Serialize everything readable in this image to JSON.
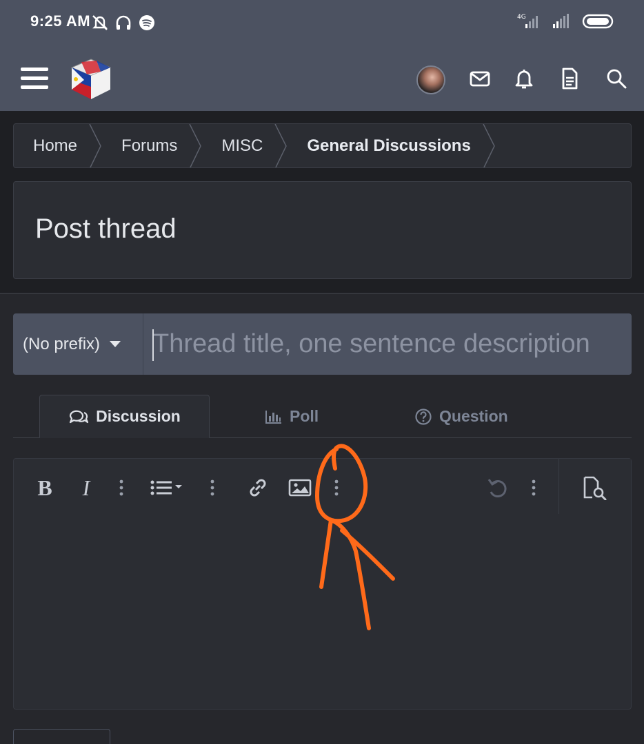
{
  "status_bar": {
    "time": "9:25 AM",
    "left_icons": [
      "mute-notifications-icon",
      "headphones-icon",
      "spotify-icon"
    ],
    "right_icons": [
      "4g-signal-icon",
      "signal-icon",
      "battery-icon"
    ],
    "network": "4G"
  },
  "header": {
    "menu_icon": "hamburger-icon",
    "logo": "site-logo",
    "icons": [
      "avatar",
      "mail-icon",
      "bell-icon",
      "document-icon",
      "search-icon"
    ]
  },
  "breadcrumb": {
    "items": [
      "Home",
      "Forums",
      "MISC",
      "General Discussions"
    ]
  },
  "page": {
    "title": "Post thread"
  },
  "thread_form": {
    "prefix_value": "(No prefix)",
    "title_placeholder": "Thread title, one sentence description"
  },
  "tabs": [
    {
      "label": "Discussion",
      "icon": "chat-bubbles-icon",
      "active": true
    },
    {
      "label": "Poll",
      "icon": "bar-chart-icon",
      "active": false
    },
    {
      "label": "Question",
      "icon": "question-circle-icon",
      "active": false
    }
  ],
  "toolbar": {
    "bold": "B",
    "italic": "I",
    "buttons": [
      "bold-button",
      "italic-button",
      "more-text-options",
      "list-button",
      "more-paragraph-options",
      "link-button",
      "image-button",
      "more-insert-options",
      "undo-button",
      "more-misc-options",
      "preview-button"
    ]
  },
  "colors": {
    "header_bg": "#4c5261",
    "page_bg": "#26272c",
    "panel_bg": "#2b2d33",
    "annotation": "#ff6a1a"
  }
}
